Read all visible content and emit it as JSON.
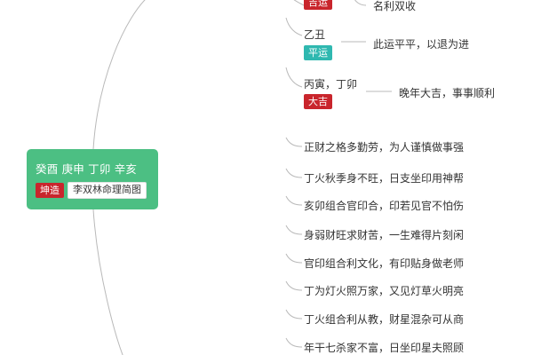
{
  "root": {
    "title": "癸酉 庚申 丁卯 辛亥",
    "tag_gender": "坤造",
    "tag_name": "李双林命理简图"
  },
  "periods": [
    {
      "label": "",
      "badge": "吉运",
      "badge_color": "#c9252c",
      "desc": "名利双收"
    },
    {
      "label": "乙丑",
      "badge": "平运",
      "badge_color": "#2fb8b0",
      "desc": "此运平平，以退为进"
    },
    {
      "label": "丙寅，丁卯",
      "badge": "大吉",
      "badge_color": "#c9252c",
      "desc": "晚年大吉，事事顺利"
    }
  ],
  "traits": [
    "正财之格多勤劳，为人谨慎做事强",
    "丁火秋季身不旺，日支坐印用神帮",
    "亥卯组合官印合，印若见官不怕伤",
    "身弱财旺求财苦，一生难得片刻闲",
    "官印组合利文化，有印贴身做老师",
    "丁为灯火照万家，又见灯草火明亮",
    "丁火组合利从教，财星混杂可从商",
    "年干七杀家不富，日坐印星夫照顾"
  ],
  "colors": {
    "root_bg": "#4cbf83",
    "line": "#b9b9b9",
    "red": "#c9252c",
    "teal": "#2fb8b0"
  }
}
